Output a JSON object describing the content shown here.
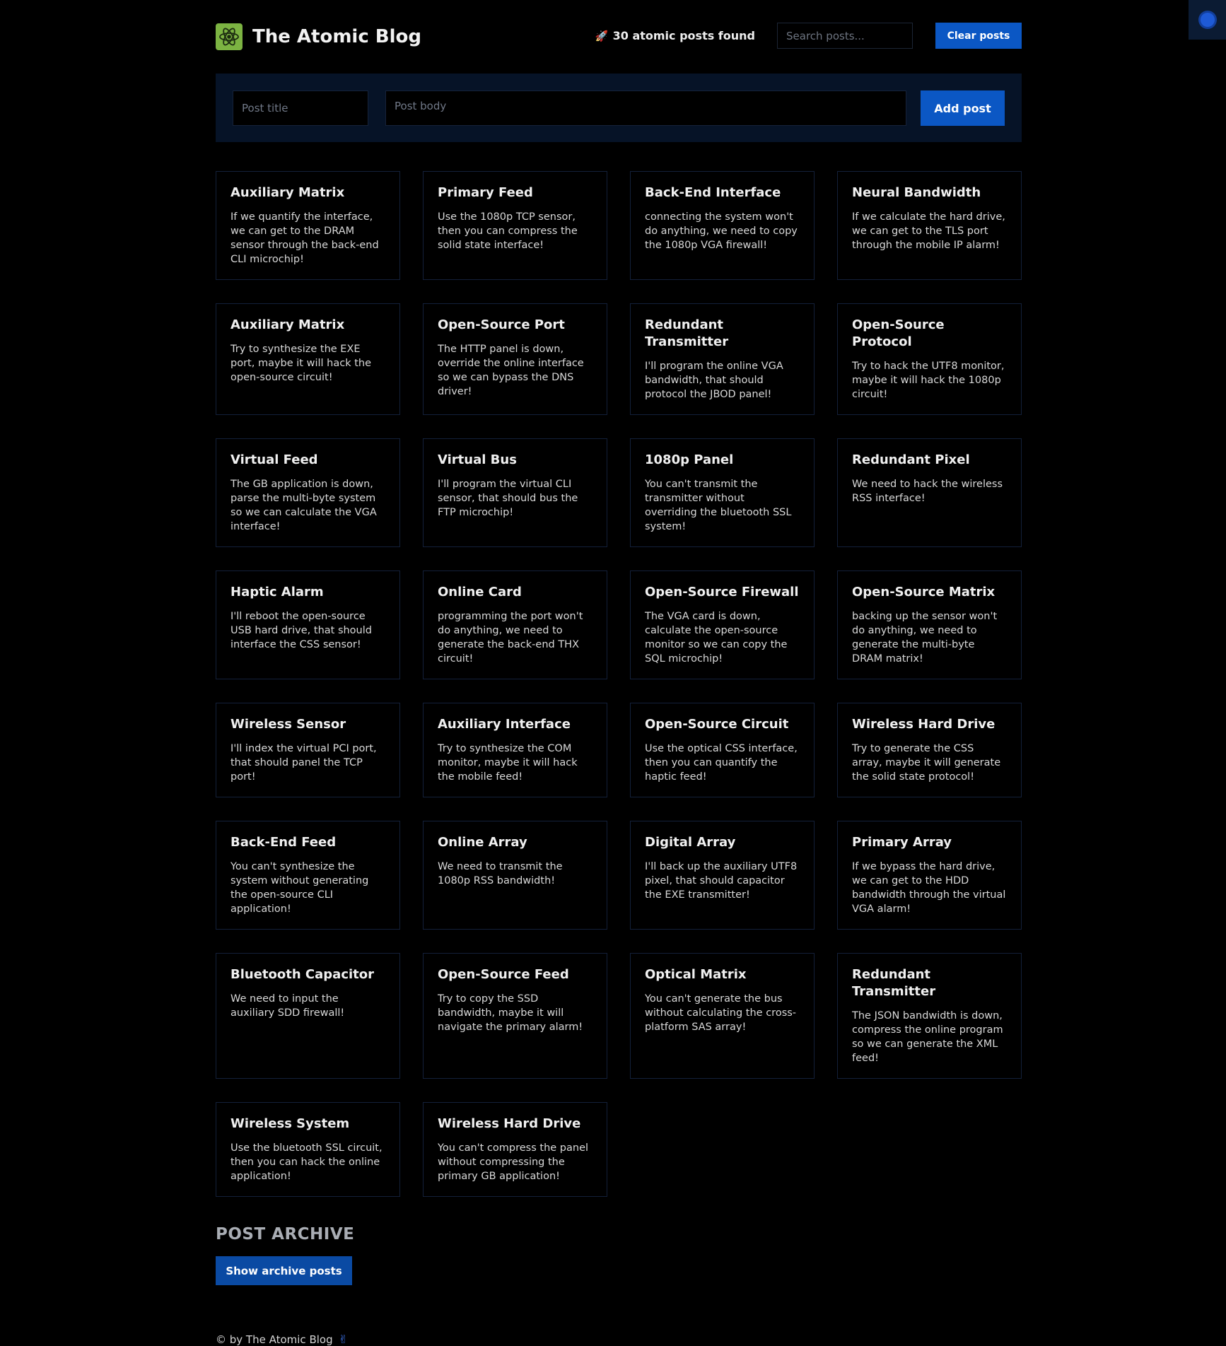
{
  "header": {
    "brand": "The Atomic Blog",
    "post_count": "30 atomic posts found",
    "search_placeholder": "Search posts...",
    "clear_label": "Clear posts"
  },
  "form": {
    "title_placeholder": "Post title",
    "body_placeholder": "Post body",
    "add_label": "Add post"
  },
  "posts": [
    {
      "title": "Auxiliary Matrix",
      "body": "If we quantify the interface, we can get to the DRAM sensor through the back-end CLI microchip!"
    },
    {
      "title": "Primary Feed",
      "body": "Use the 1080p TCP sensor, then you can compress the solid state interface!"
    },
    {
      "title": "Back-End Interface",
      "body": "connecting the system won't do anything, we need to copy the 1080p VGA firewall!"
    },
    {
      "title": "Neural Bandwidth",
      "body": "If we calculate the hard drive, we can get to the TLS port through the mobile IP alarm!"
    },
    {
      "title": "Auxiliary Matrix",
      "body": "Try to synthesize the EXE port, maybe it will hack the open-source circuit!"
    },
    {
      "title": "Open-Source Port",
      "body": "The HTTP panel is down, override the online interface so we can bypass the DNS driver!"
    },
    {
      "title": "Redundant Transmitter",
      "body": "I'll program the online VGA bandwidth, that should protocol the JBOD panel!"
    },
    {
      "title": "Open-Source Protocol",
      "body": "Try to hack the UTF8 monitor, maybe it will hack the 1080p circuit!"
    },
    {
      "title": "Virtual Feed",
      "body": "The GB application is down, parse the multi-byte system so we can calculate the VGA interface!"
    },
    {
      "title": "Virtual Bus",
      "body": "I'll program the virtual CLI sensor, that should bus the FTP microchip!"
    },
    {
      "title": "1080p Panel",
      "body": "You can't transmit the transmitter without overriding the bluetooth SSL system!"
    },
    {
      "title": "Redundant Pixel",
      "body": "We need to hack the wireless RSS interface!"
    },
    {
      "title": "Haptic Alarm",
      "body": "I'll reboot the open-source USB hard drive, that should interface the CSS sensor!"
    },
    {
      "title": "Online Card",
      "body": "programming the port won't do anything, we need to generate the back-end THX circuit!"
    },
    {
      "title": "Open-Source Firewall",
      "body": "The VGA card is down, calculate the open-source monitor so we can copy the SQL microchip!"
    },
    {
      "title": "Open-Source Matrix",
      "body": "backing up the sensor won't do anything, we need to generate the multi-byte DRAM matrix!"
    },
    {
      "title": "Wireless Sensor",
      "body": "I'll index the virtual PCI port, that should panel the TCP port!"
    },
    {
      "title": "Auxiliary Interface",
      "body": "Try to synthesize the COM monitor, maybe it will hack the mobile feed!"
    },
    {
      "title": "Open-Source Circuit",
      "body": "Use the optical CSS interface, then you can quantify the haptic feed!"
    },
    {
      "title": "Wireless Hard Drive",
      "body": "Try to generate the CSS array, maybe it will generate the solid state protocol!"
    },
    {
      "title": "Back-End Feed",
      "body": "You can't synthesize the system without generating the open-source CLI application!"
    },
    {
      "title": "Online Array",
      "body": "We need to transmit the 1080p RSS bandwidth!"
    },
    {
      "title": "Digital Array",
      "body": "I'll back up the auxiliary UTF8 pixel, that should capacitor the EXE transmitter!"
    },
    {
      "title": "Primary Array",
      "body": "If we bypass the hard drive, we can get to the HDD bandwidth through the virtual VGA alarm!"
    },
    {
      "title": "Bluetooth Capacitor",
      "body": "We need to input the auxiliary SDD firewall!"
    },
    {
      "title": "Open-Source Feed",
      "body": "Try to copy the SSD bandwidth, maybe it will navigate the primary alarm!"
    },
    {
      "title": "Optical Matrix",
      "body": "You can't generate the bus without calculating the cross-platform SAS array!"
    },
    {
      "title": "Redundant Transmitter",
      "body": "The JSON bandwidth is down, compress the online program so we can generate the XML feed!"
    },
    {
      "title": "Wireless System",
      "body": "Use the bluetooth SSL circuit, then you can hack the online application!"
    },
    {
      "title": "Wireless Hard Drive",
      "body": "You can't compress the panel without compressing the primary GB application!"
    }
  ],
  "archive": {
    "title": "POST ARCHIVE",
    "button_label": "Show archive posts"
  },
  "footer": {
    "text": "© by The Atomic Blog"
  },
  "colors": {
    "background": "#000000",
    "accent": "#0b57c4",
    "logo": "#7cb342"
  },
  "icons": {
    "logo": "atom-icon",
    "count": "rocket-icon",
    "footer": "victory-hand-icon",
    "corner": "circle-toggle-icon"
  }
}
